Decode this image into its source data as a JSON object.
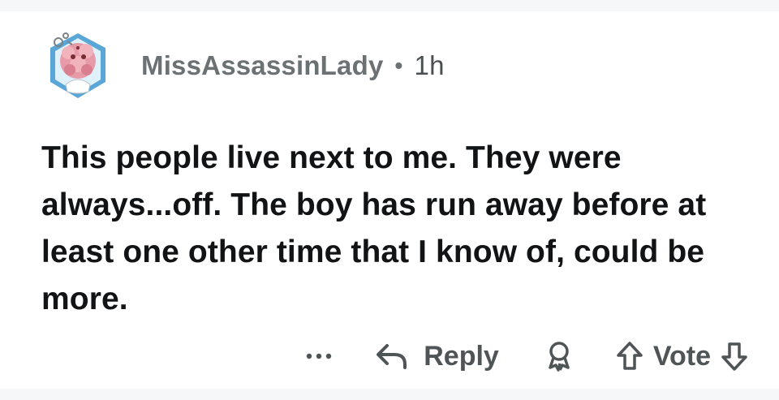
{
  "comment": {
    "username": "MissAssassinLady",
    "separator": "•",
    "time": "1h",
    "text": "This people live next to me. They were always...off. The boy has run away before at least one other time that I know of, could be more."
  },
  "actions": {
    "more_label": "...",
    "reply_label": "Reply",
    "vote_label": "Vote"
  },
  "icons": {
    "more": "more-options-icon",
    "reply": "reply-arrow-icon",
    "award": "award-icon",
    "upvote": "upvote-arrow-icon",
    "downvote": "downvote-arrow-icon"
  },
  "colors": {
    "page_background": "#f6f7f8",
    "card_background": "#ffffff",
    "meta_text": "#6c7174",
    "body_text": "#111315",
    "action_text": "#4f5457",
    "avatar_ring": "#5aa6d6",
    "avatar_pink": "#e79aa7"
  }
}
